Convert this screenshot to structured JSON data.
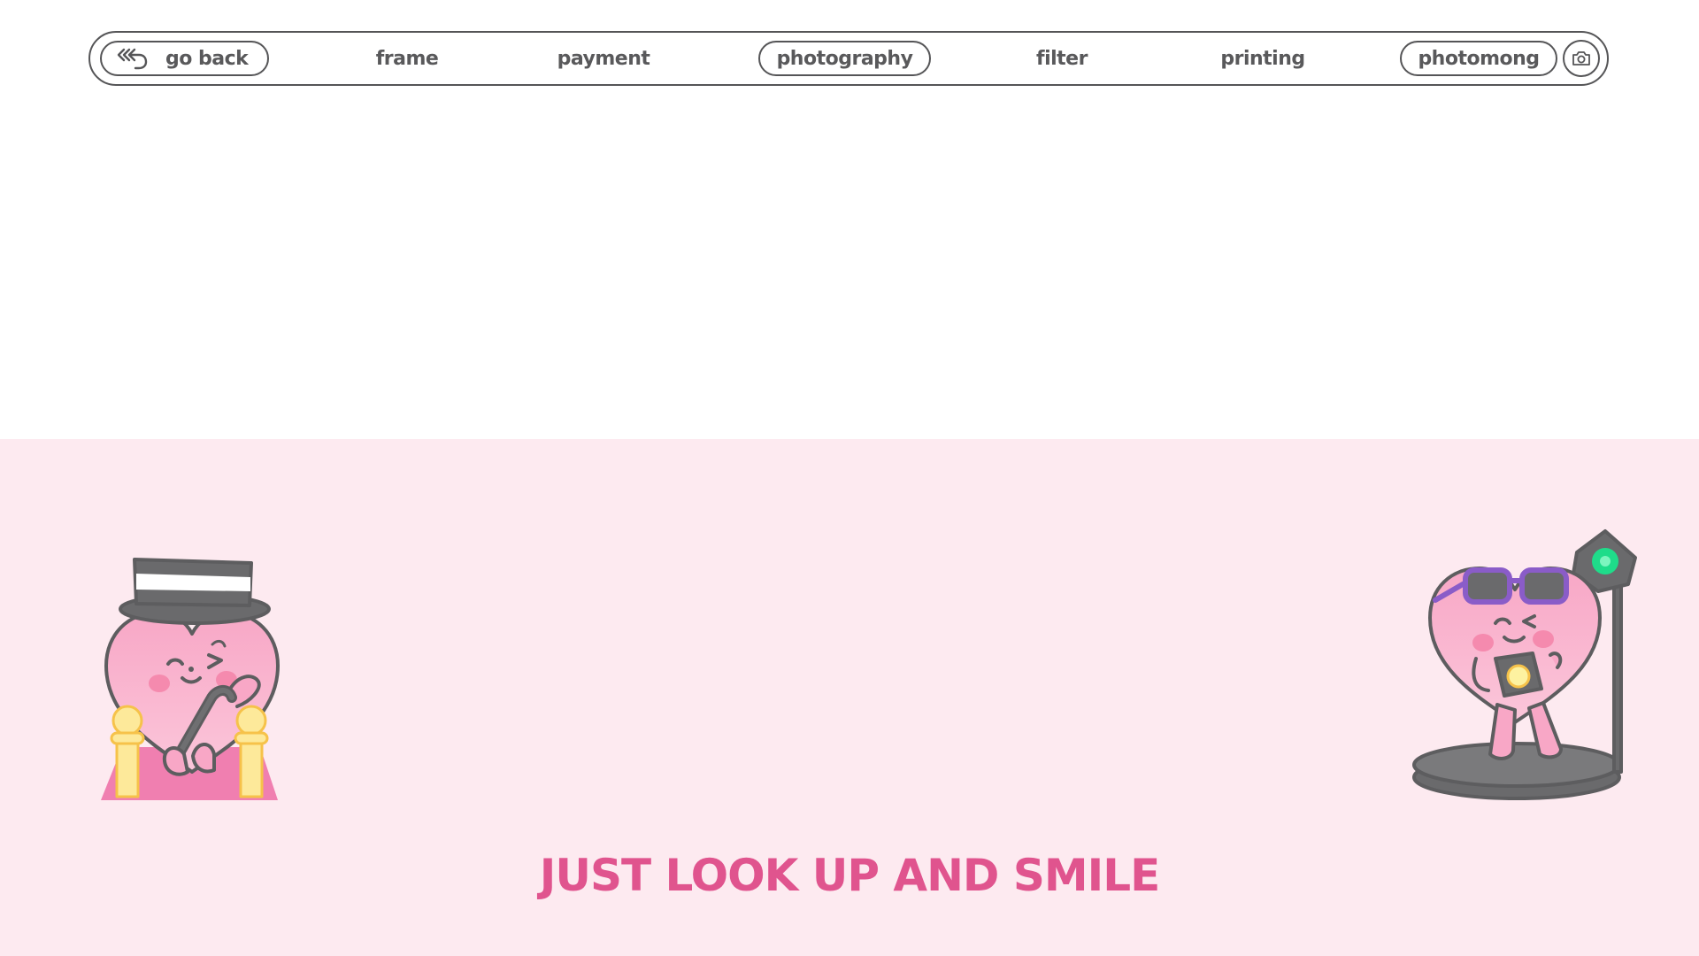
{
  "nav": {
    "back_label": "go back",
    "items": [
      {
        "id": "frame",
        "label": "frame",
        "active": false
      },
      {
        "id": "payment",
        "label": "payment",
        "active": false
      },
      {
        "id": "photography",
        "label": "photography",
        "active": true
      },
      {
        "id": "filter",
        "label": "filter",
        "active": false
      },
      {
        "id": "printing",
        "label": "printing",
        "active": false
      }
    ],
    "brand_label": "photomong",
    "icons": {
      "back": "back-arrows-icon",
      "camera": "camera-icon"
    }
  },
  "panel": {
    "tagline": "JUST LOOK UP AND SMILE",
    "illustrations": [
      "heart-mascot-top-hat-cane",
      "heart-mascot-sunglasses-camera-spotlight"
    ]
  },
  "colors": {
    "outline": "#555557",
    "text": "#59595b",
    "panel_background": "#fdeaf0",
    "accent_pink": "#e0548e",
    "mascot_pink": "#f7a1c0",
    "gold": "#fde99a",
    "spotlight_green": "#1fdc8a",
    "sunglasses_frame": "#8a5cc8"
  }
}
